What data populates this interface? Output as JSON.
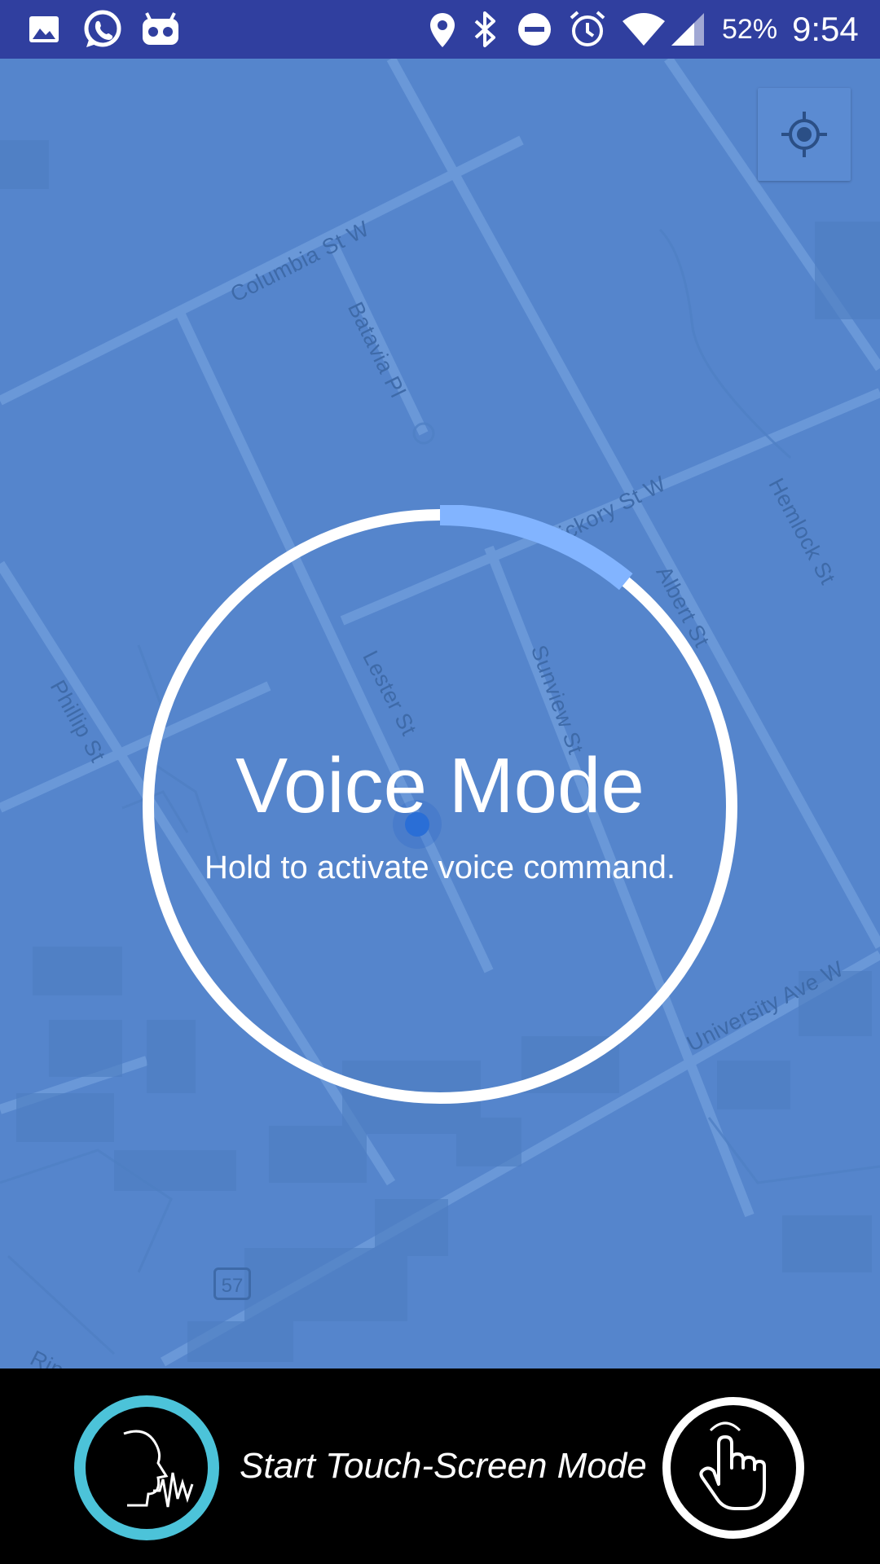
{
  "status_bar": {
    "battery": "52%",
    "time": "9:54",
    "icons": [
      "image-icon",
      "whatsapp-icon",
      "android-icon",
      "location-pin-icon",
      "bluetooth-icon",
      "do-not-disturb-icon",
      "alarm-icon",
      "wifi-icon",
      "cell-signal-icon"
    ]
  },
  "map": {
    "streets": {
      "columbia": "Columbia St W",
      "batavia": "Batavia Pl",
      "hickory": "Hickory St W",
      "albert": "Albert St",
      "hemlock": "Hemlock St",
      "phillip": "Phillip St",
      "lester": "Lester St",
      "sunview": "Sunview St",
      "university": "University Ave W",
      "rim": "Rin"
    },
    "route_shield": "57",
    "locate_button_icon": "my-location-icon"
  },
  "voice": {
    "title": "Voice Mode",
    "subtitle": "Hold to activate voice command.",
    "progress": 0.11,
    "ring_color": "#ffffff",
    "progress_color": "#82b4ff"
  },
  "bottom_bar": {
    "touch_mode_label": "Start Touch-Screen Mode",
    "voice_icon": "speaking-head-icon",
    "touch_icon": "hand-pointer-icon",
    "voice_icon_ring_color": "#4cc3d9"
  }
}
